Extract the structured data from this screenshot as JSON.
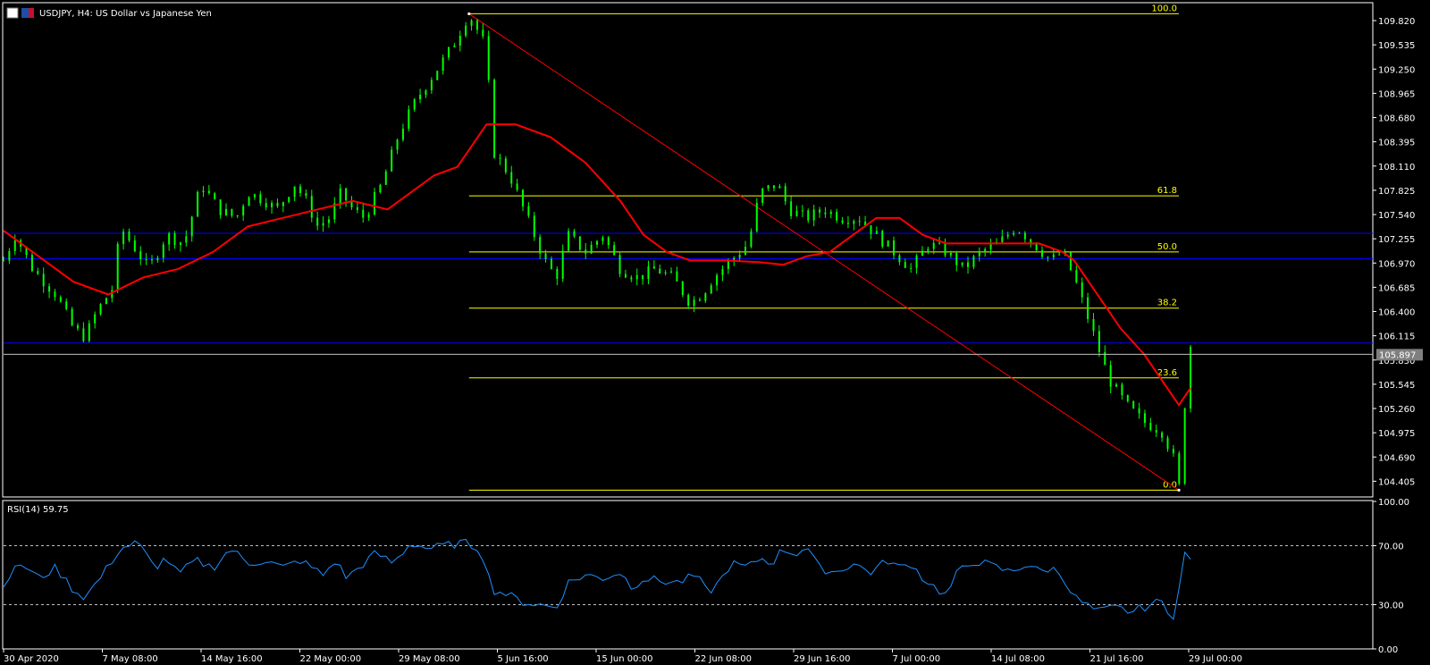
{
  "window": {
    "title": "USDJPY, H4:  US Dollar vs Japanese Yen",
    "symbol": "USDJPY",
    "timeframe": "H4",
    "description": "US Dollar vs Japanese Yen"
  },
  "colors": {
    "background": "#000000",
    "frame": "#ffffff",
    "bull_candle": "#00ff00",
    "moving_average": "#ff0000",
    "trendline": "#ff0000",
    "fibonacci": "#ffff00",
    "horizontal_lines": "#0000ff",
    "bid_line": "#c0c0c0",
    "rsi_line": "#1e90ff",
    "rsi_levels": "#c0c0c0"
  },
  "chart_data": [
    {
      "type": "candlestick",
      "title": "USDJPY, H4:  US Dollar vs Japanese Yen",
      "ylim": [
        104.22,
        110.02
      ],
      "y_ticks": [
        "109.820",
        "109.535",
        "109.250",
        "108.965",
        "108.680",
        "108.395",
        "108.110",
        "107.825",
        "107.540",
        "107.255",
        "106.970",
        "106.685",
        "106.400",
        "106.115",
        "105.830",
        "105.545",
        "105.260",
        "104.975",
        "104.690",
        "104.405"
      ],
      "x_ticks": [
        "30 Apr 2020",
        "7 May 08:00",
        "14 May 16:00",
        "22 May 00:00",
        "29 May 08:00",
        "5 Jun 16:00",
        "15 Jun 00:00",
        "22 Jun 08:00",
        "29 Jun 16:00",
        "7 Jul 00:00",
        "14 Jul 08:00",
        "21 Jul 16:00",
        "29 Jul 00:00"
      ],
      "current_price": "105.897",
      "price_path": [
        [
          0,
          107.0
        ],
        [
          2,
          107.3
        ],
        [
          5,
          106.9
        ],
        [
          9,
          106.6
        ],
        [
          12,
          106.2
        ],
        [
          14,
          106.1
        ],
        [
          16,
          106.4
        ],
        [
          19,
          106.7
        ],
        [
          20,
          107.4
        ],
        [
          23,
          107.1
        ],
        [
          25,
          106.9
        ],
        [
          28,
          107.3
        ],
        [
          31,
          107.2
        ],
        [
          34,
          107.9
        ],
        [
          37,
          107.6
        ],
        [
          40,
          107.5
        ],
        [
          42,
          107.8
        ],
        [
          45,
          107.7
        ],
        [
          47,
          107.6
        ],
        [
          50,
          107.9
        ],
        [
          52,
          107.7
        ],
        [
          54,
          107.4
        ],
        [
          56,
          107.5
        ],
        [
          58,
          107.8
        ],
        [
          60,
          107.6
        ],
        [
          62,
          107.5
        ],
        [
          65,
          107.9
        ],
        [
          68,
          108.5
        ],
        [
          71,
          108.9
        ],
        [
          74,
          109.2
        ],
        [
          77,
          109.5
        ],
        [
          80,
          109.9
        ],
        [
          83,
          109.5
        ],
        [
          84,
          108.3
        ],
        [
          87,
          108.0
        ],
        [
          90,
          107.5
        ],
        [
          93,
          107.0
        ],
        [
          95,
          106.8
        ],
        [
          97,
          107.3
        ],
        [
          100,
          107.1
        ],
        [
          103,
          107.3
        ],
        [
          106,
          106.9
        ],
        [
          109,
          106.8
        ],
        [
          112,
          106.9
        ],
        [
          115,
          106.8
        ],
        [
          118,
          106.5
        ],
        [
          120,
          106.6
        ],
        [
          122,
          106.8
        ],
        [
          125,
          107.0
        ],
        [
          128,
          107.2
        ],
        [
          130,
          107.8
        ],
        [
          133,
          107.9
        ],
        [
          135,
          107.6
        ],
        [
          138,
          107.5
        ],
        [
          141,
          107.6
        ],
        [
          144,
          107.5
        ],
        [
          147,
          107.5
        ],
        [
          150,
          107.3
        ],
        [
          153,
          107.1
        ],
        [
          156,
          106.9
        ],
        [
          159,
          107.2
        ],
        [
          162,
          107.1
        ],
        [
          165,
          106.9
        ],
        [
          168,
          107.1
        ],
        [
          171,
          107.2
        ],
        [
          174,
          107.4
        ],
        [
          177,
          107.2
        ],
        [
          180,
          107.0
        ],
        [
          182,
          107.1
        ],
        [
          184,
          106.8
        ],
        [
          186,
          106.4
        ],
        [
          188,
          106.0
        ],
        [
          190,
          105.6
        ],
        [
          193,
          105.3
        ],
        [
          196,
          105.1
        ],
        [
          199,
          105.0
        ],
        [
          201,
          104.7
        ],
        [
          202,
          104.3
        ],
        [
          203,
          105.3
        ],
        [
          204,
          106.0
        ]
      ],
      "series": [
        {
          "name": "MA",
          "type": "line",
          "points": [
            [
              0,
              107.35
            ],
            [
              6,
              107.05
            ],
            [
              12,
              106.75
            ],
            [
              18,
              106.6
            ],
            [
              24,
              106.8
            ],
            [
              30,
              106.9
            ],
            [
              36,
              107.1
            ],
            [
              42,
              107.4
            ],
            [
              48,
              107.5
            ],
            [
              54,
              107.6
            ],
            [
              60,
              107.7
            ],
            [
              66,
              107.6
            ],
            [
              70,
              107.8
            ],
            [
              74,
              108.0
            ],
            [
              78,
              108.1
            ],
            [
              80,
              108.3
            ],
            [
              83,
              108.6
            ],
            [
              88,
              108.6
            ],
            [
              94,
              108.45
            ],
            [
              100,
              108.15
            ],
            [
              106,
              107.7
            ],
            [
              110,
              107.3
            ],
            [
              114,
              107.1
            ],
            [
              118,
              107.0
            ],
            [
              124,
              107.0
            ],
            [
              130,
              106.98
            ],
            [
              134,
              106.95
            ],
            [
              138,
              107.05
            ],
            [
              142,
              107.1
            ],
            [
              146,
              107.3
            ],
            [
              150,
              107.5
            ],
            [
              154,
              107.5
            ],
            [
              158,
              107.3
            ],
            [
              162,
              107.2
            ],
            [
              166,
              107.2
            ],
            [
              170,
              107.2
            ],
            [
              174,
              107.2
            ],
            [
              178,
              107.2
            ],
            [
              182,
              107.1
            ],
            [
              184,
              107.0
            ],
            [
              188,
              106.6
            ],
            [
              192,
              106.2
            ],
            [
              196,
              105.9
            ],
            [
              198,
              105.7
            ],
            [
              200,
              105.5
            ],
            [
              202,
              105.3
            ],
            [
              204,
              105.5
            ]
          ]
        }
      ],
      "trendline": {
        "from": [
          80,
          109.9
        ],
        "to": [
          202,
          104.3
        ]
      },
      "fibonacci": {
        "high": 109.9,
        "low": 104.3,
        "levels": [
          {
            "label": "100.0",
            "value": 109.9
          },
          {
            "label": "61.8",
            "value": 107.76
          },
          {
            "label": "50.0",
            "value": 107.1
          },
          {
            "label": "38.2",
            "value": 106.44
          },
          {
            "label": "23.6",
            "value": 105.62
          },
          {
            "label": "0.0",
            "value": 104.3
          }
        ]
      },
      "horizontal_lines": [
        107.32,
        107.02,
        106.03
      ],
      "grid": false
    },
    {
      "type": "line",
      "title": "RSI(14) 59.75",
      "indicator": "RSI(14)",
      "value": "59.75",
      "ylim": [
        0,
        100
      ],
      "y_ticks": [
        "100.00",
        "70.00",
        "30.00",
        "0.00"
      ],
      "levels": [
        70,
        30
      ],
      "series": [
        {
          "name": "RSI",
          "points": [
            [
              0,
              45
            ],
            [
              3,
              58
            ],
            [
              6,
              48
            ],
            [
              9,
              55
            ],
            [
              12,
              40
            ],
            [
              14,
              35
            ],
            [
              17,
              50
            ],
            [
              20,
              68
            ],
            [
              23,
              72
            ],
            [
              26,
              55
            ],
            [
              28,
              62
            ],
            [
              30,
              50
            ],
            [
              33,
              60
            ],
            [
              36,
              55
            ],
            [
              39,
              68
            ],
            [
              42,
              58
            ],
            [
              45,
              60
            ],
            [
              48,
              55
            ],
            [
              51,
              60
            ],
            [
              53,
              55
            ],
            [
              55,
              50
            ],
            [
              57,
              60
            ],
            [
              59,
              48
            ],
            [
              61,
              55
            ],
            [
              64,
              65
            ],
            [
              67,
              58
            ],
            [
              70,
              72
            ],
            [
              73,
              68
            ],
            [
              76,
              70
            ],
            [
              79,
              72
            ],
            [
              82,
              68
            ],
            [
              84,
              40
            ],
            [
              86,
              38
            ],
            [
              89,
              32
            ],
            [
              92,
              30
            ],
            [
              95,
              28
            ],
            [
              97,
              45
            ],
            [
              100,
              50
            ],
            [
              103,
              48
            ],
            [
              106,
              52
            ],
            [
              108,
              42
            ],
            [
              110,
              48
            ],
            [
              113,
              46
            ],
            [
              116,
              45
            ],
            [
              119,
              50
            ],
            [
              121,
              38
            ],
            [
              123,
              45
            ],
            [
              125,
              58
            ],
            [
              128,
              55
            ],
            [
              130,
              62
            ],
            [
              132,
              58
            ],
            [
              134,
              68
            ],
            [
              136,
              64
            ],
            [
              138,
              70
            ],
            [
              140,
              55
            ],
            [
              143,
              52
            ],
            [
              146,
              58
            ],
            [
              149,
              52
            ],
            [
              152,
              60
            ],
            [
              154,
              55
            ],
            [
              156,
              58
            ],
            [
              158,
              48
            ],
            [
              160,
              42
            ],
            [
              162,
              36
            ],
            [
              164,
              52
            ],
            [
              167,
              60
            ],
            [
              170,
              56
            ],
            [
              173,
              52
            ],
            [
              176,
              58
            ],
            [
              178,
              52
            ],
            [
              180,
              55
            ],
            [
              182,
              50
            ],
            [
              184,
              35
            ],
            [
              186,
              30
            ],
            [
              188,
              25
            ],
            [
              191,
              28
            ],
            [
              194,
              25
            ],
            [
              197,
              30
            ],
            [
              199,
              32
            ],
            [
              201,
              22
            ],
            [
              202,
              40
            ],
            [
              203,
              64
            ],
            [
              204,
              60
            ]
          ]
        }
      ],
      "grid": false
    }
  ]
}
